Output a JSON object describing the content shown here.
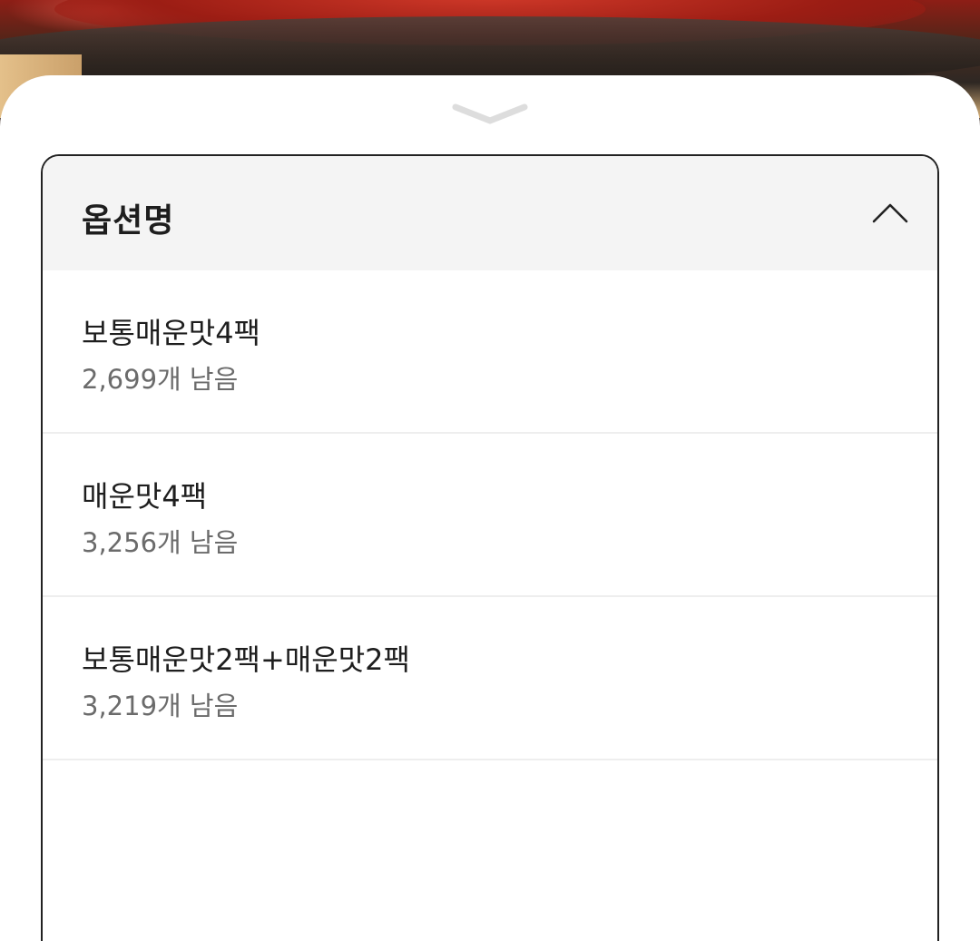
{
  "sheet": {
    "title": "옵션명",
    "options": [
      {
        "name": "보통매운맛4팩",
        "stock": "2,699개 남음"
      },
      {
        "name": "매운맛4팩",
        "stock": "3,256개 남음"
      },
      {
        "name": "보통매운맛2팩+매운맛2팩",
        "stock": "3,219개 남음"
      }
    ]
  },
  "colors": {
    "header_bg": "#f4f4f4",
    "border": "#222222",
    "text_primary": "#1e1e1e",
    "text_secondary": "#6b6b6b"
  },
  "icons": {
    "handle": "chevron-down-icon",
    "collapse": "chevron-up-icon"
  }
}
